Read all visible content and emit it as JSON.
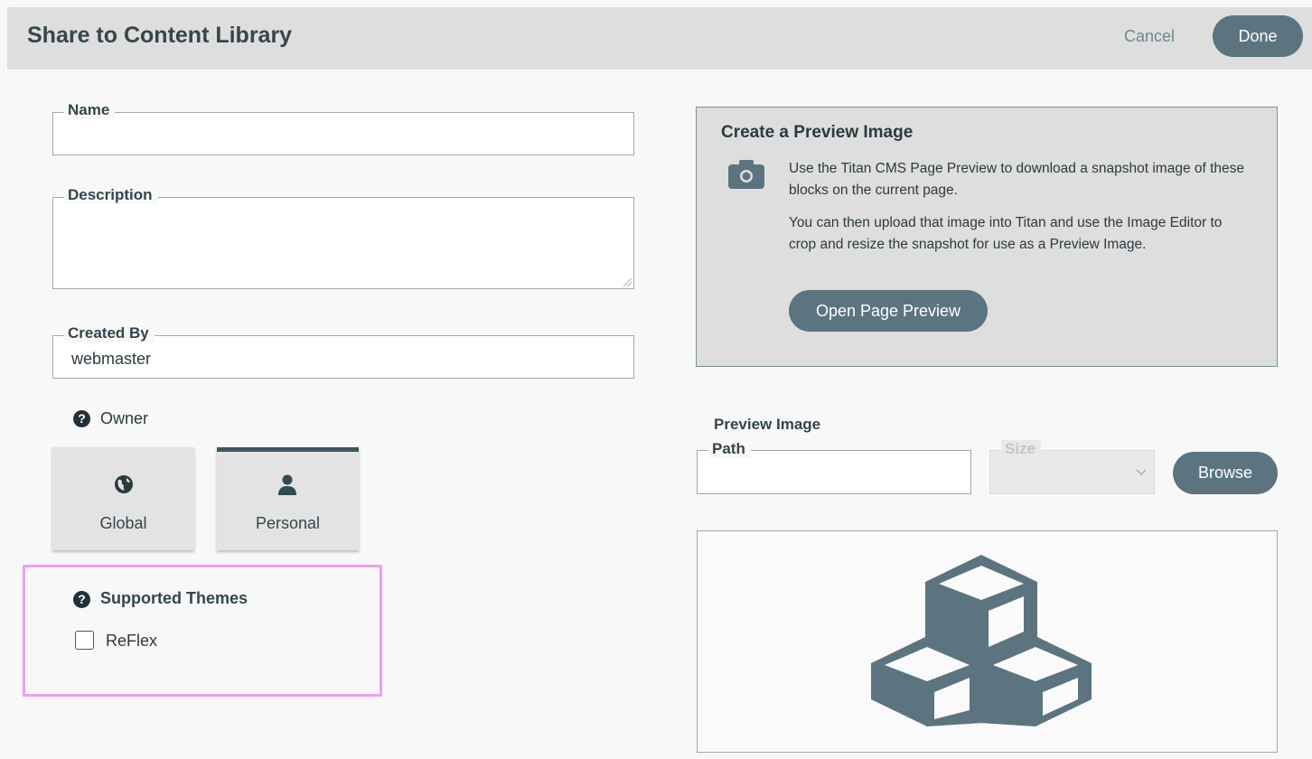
{
  "header": {
    "title": "Share to Content Library",
    "cancel_label": "Cancel",
    "done_label": "Done"
  },
  "form": {
    "name_label": "Name",
    "name_value": "",
    "description_label": "Description",
    "description_value": "",
    "created_by_label": "Created By",
    "created_by_value": "webmaster",
    "owner_label": "Owner",
    "owner_options": [
      {
        "label": "Global",
        "icon": "globe-icon",
        "selected": false
      },
      {
        "label": "Personal",
        "icon": "user-icon",
        "selected": true
      }
    ],
    "supported_themes_label": "Supported Themes",
    "themes": [
      {
        "label": "ReFlex",
        "checked": false
      }
    ]
  },
  "preview_panel": {
    "title": "Create a Preview Image",
    "text1": "Use the Titan CMS Page Preview to download a snapshot image of these blocks on the current page.",
    "text2": "You can then upload that image into Titan and use the Image Editor to crop and resize the snapshot for use as a Preview Image.",
    "button_label": "Open Page Preview",
    "icon": "camera-icon"
  },
  "preview_image": {
    "heading": "Preview Image",
    "path_label": "Path",
    "path_value": "",
    "size_label": "Size",
    "size_value": "",
    "browse_label": "Browse",
    "placeholder_icon": "cubes-icon"
  },
  "colors": {
    "button": "#5c7480",
    "header_bg": "#dedede",
    "highlight": "#ee9ff0"
  }
}
